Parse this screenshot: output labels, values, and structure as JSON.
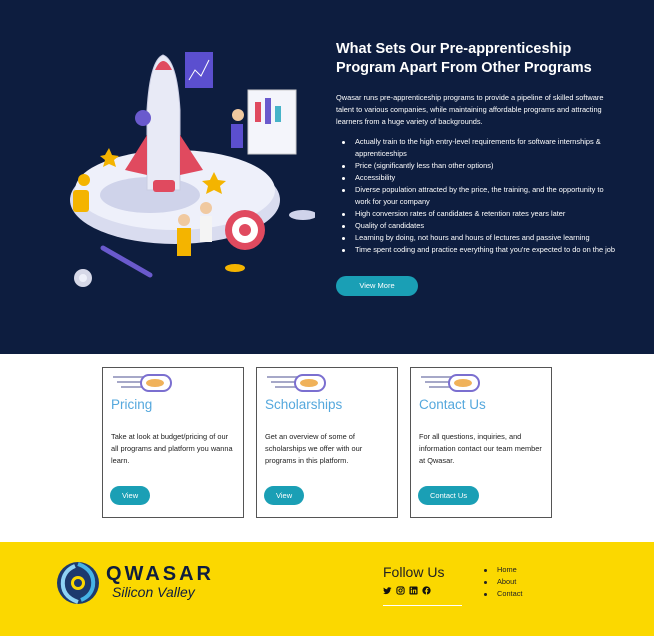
{
  "hero": {
    "title": "What Sets Our Pre-apprenticeship Program Apart From Other Programs",
    "intro": "Qwasar runs pre-apprenticeship programs to provide a pipeline of skilled software talent to various companies, while maintaining affordable programs and attracting learners from a huge variety of backgrounds.",
    "bullets": [
      "Actually train to the high entry-level requirements for software internships & apprenticeships",
      "Price (significantly less than other options)",
      "Accessibility",
      "Diverse population attracted by the price, the training, and the opportunity to work for your company",
      "High conversion rates of candidates & retention rates years later",
      "Quality of candidates",
      "Learning by doing, not hours and hours of lectures and passive learning",
      "Time spent coding and practice everything that you're expected to do on the job"
    ],
    "button": "View More"
  },
  "cards": [
    {
      "title": "Pricing",
      "desc": "Take at look at budget/pricing of our all programs and platform you wanna learn.",
      "button": "View"
    },
    {
      "title": "Scholarships",
      "desc": "Get an overview of some of scholarships we offer with our programs in this platform.",
      "button": "View"
    },
    {
      "title": "Contact Us",
      "desc": "For all questions, inquiries, and information contact our team member at Qwasar.",
      "button": "Contact Us"
    }
  ],
  "footer": {
    "brand": "QWASAR",
    "subtitle": "Silicon Valley",
    "follow": "Follow Us",
    "social_icons": [
      "twitter-icon",
      "instagram-icon",
      "linkedin-icon",
      "facebook-icon"
    ],
    "links": [
      "Home",
      "About",
      "Contact"
    ]
  },
  "colors": {
    "hero_bg": "#0d1d3f",
    "accent": "#1a9fb5",
    "card_title": "#55a8dd",
    "footer_bg": "#fbd800"
  }
}
